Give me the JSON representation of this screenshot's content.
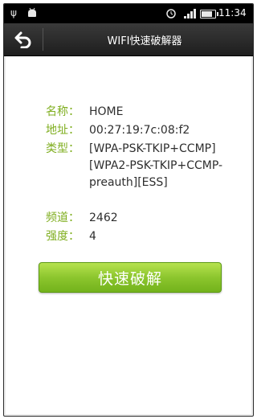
{
  "status_bar": {
    "time": "11:34",
    "battery_level": 0.8,
    "icons": [
      "usb-icon",
      "android-icon",
      "alarm-icon",
      "signal-icon",
      "battery-icon"
    ]
  },
  "title_bar": {
    "title": "WIFI快速破解器",
    "back_icon": "back-arrow-icon"
  },
  "network": {
    "name_label": "名称：",
    "name": "HOME",
    "address_label": "地址：",
    "address": "00:27:19:7c:08:f2",
    "type_label": "类型：",
    "type": "[WPA-PSK-TKIP+CCMP][WPA2-PSK-TKIP+CCMP-preauth][ESS]",
    "frequency_label": "频道：",
    "frequency": "2462",
    "strength_label": "强度：",
    "strength": "4"
  },
  "actions": {
    "crack_label": "快速破解"
  },
  "colors": {
    "label": "#7fae1f",
    "value": "#2e2e2e",
    "button": "#8cc62e",
    "title_bar": "#2a2a2a"
  }
}
